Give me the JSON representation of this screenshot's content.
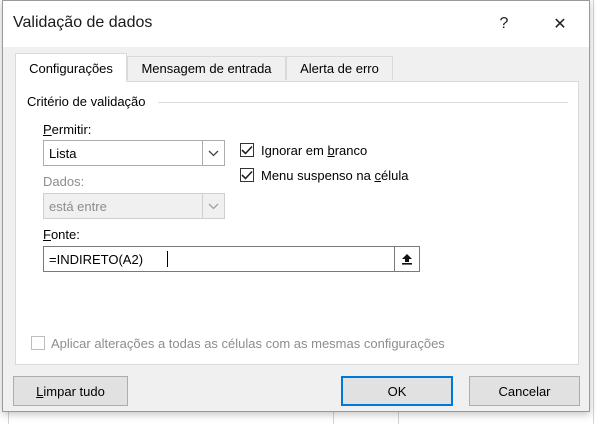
{
  "dialog": {
    "title": "Validação de dados",
    "help_label": "?",
    "close_label": "✕"
  },
  "tabs": [
    {
      "label": "Configurações",
      "active": true
    },
    {
      "label": "Mensagem de entrada",
      "active": false
    },
    {
      "label": "Alerta de erro",
      "active": false
    }
  ],
  "group": {
    "label": "Critério de validação"
  },
  "allow": {
    "label_accel": "P",
    "label_rest": "ermitir:",
    "value": "Lista"
  },
  "data": {
    "label": "Dados:",
    "value": "está entre",
    "enabled": false
  },
  "ignore_blank": {
    "label_pre": "Ignorar em ",
    "label_accel": "b",
    "label_post": "ranco",
    "checked": true
  },
  "in_cell_dropdown": {
    "label_pre": "Menu suspenso na ",
    "label_accel": "c",
    "label_post": "élula",
    "checked": true
  },
  "source": {
    "label_accel": "F",
    "label_rest": "onte:",
    "value": "=INDIRETO(A2)",
    "button_icon": "collapse-dialog-icon"
  },
  "apply_all": {
    "label": "Aplicar alterações a todas as células com as mesmas configurações",
    "checked": false,
    "enabled": false
  },
  "buttons": {
    "clear_accel": "L",
    "clear_rest": "impar tudo",
    "ok": "OK",
    "cancel": "Cancelar"
  },
  "colors": {
    "accent": "#0078d7",
    "panel": "#ffffff",
    "dialog_bg": "#f0f0f0"
  }
}
